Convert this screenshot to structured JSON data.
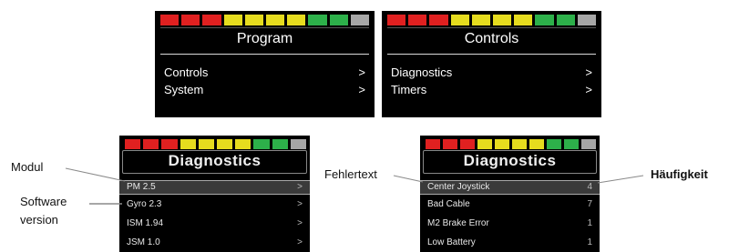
{
  "status_bar_colors": [
    "#e02020",
    "#e02020",
    "#e02020",
    "#e6dc1e",
    "#e6dc1e",
    "#e6dc1e",
    "#e6dc1e",
    "#2db04a",
    "#2db04a",
    "#a6a6a6"
  ],
  "program_screen": {
    "title": "Program",
    "items": [
      {
        "label": "Controls",
        "chevron": ">"
      },
      {
        "label": "System",
        "chevron": ">"
      }
    ]
  },
  "controls_screen": {
    "title": "Controls",
    "items": [
      {
        "label": "Diagnostics",
        "chevron": ">"
      },
      {
        "label": "Timers",
        "chevron": ">"
      }
    ]
  },
  "diagnostics_modules_screen": {
    "title": "Diagnostics",
    "items": [
      {
        "label": "PM 2.5",
        "chevron": ">"
      },
      {
        "label": "Gyro 2.3",
        "chevron": ">"
      },
      {
        "label": "ISM 1.94",
        "chevron": ">"
      },
      {
        "label": "JSM 1.0",
        "chevron": ">"
      }
    ]
  },
  "diagnostics_errors_screen": {
    "title": "Diagnostics",
    "items": [
      {
        "label": "Center Joystick",
        "count": "4"
      },
      {
        "label": "Bad Cable",
        "count": "7"
      },
      {
        "label": "M2 Brake Error",
        "count": "1"
      },
      {
        "label": "Low Battery",
        "count": "1"
      }
    ]
  },
  "callouts": {
    "modul": "Modul",
    "software_version_line1": "Software",
    "software_version_line2": "version",
    "fehlertext": "Fehlertext",
    "haeufigkeit": "Häufigkeit"
  }
}
